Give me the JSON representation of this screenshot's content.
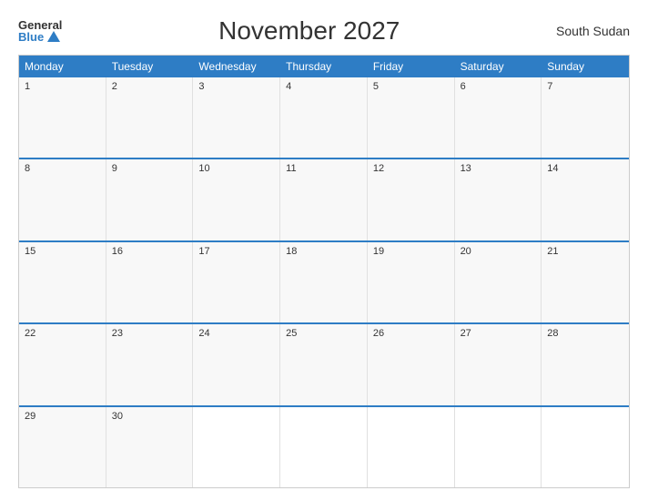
{
  "header": {
    "logo_general": "General",
    "logo_blue": "Blue",
    "title": "November 2027",
    "country": "South Sudan"
  },
  "calendar": {
    "day_headers": [
      "Monday",
      "Tuesday",
      "Wednesday",
      "Thursday",
      "Friday",
      "Saturday",
      "Sunday"
    ],
    "weeks": [
      [
        {
          "day": "1",
          "empty": false
        },
        {
          "day": "2",
          "empty": false
        },
        {
          "day": "3",
          "empty": false
        },
        {
          "day": "4",
          "empty": false
        },
        {
          "day": "5",
          "empty": false
        },
        {
          "day": "6",
          "empty": false
        },
        {
          "day": "7",
          "empty": false
        }
      ],
      [
        {
          "day": "8",
          "empty": false
        },
        {
          "day": "9",
          "empty": false
        },
        {
          "day": "10",
          "empty": false
        },
        {
          "day": "11",
          "empty": false
        },
        {
          "day": "12",
          "empty": false
        },
        {
          "day": "13",
          "empty": false
        },
        {
          "day": "14",
          "empty": false
        }
      ],
      [
        {
          "day": "15",
          "empty": false
        },
        {
          "day": "16",
          "empty": false
        },
        {
          "day": "17",
          "empty": false
        },
        {
          "day": "18",
          "empty": false
        },
        {
          "day": "19",
          "empty": false
        },
        {
          "day": "20",
          "empty": false
        },
        {
          "day": "21",
          "empty": false
        }
      ],
      [
        {
          "day": "22",
          "empty": false
        },
        {
          "day": "23",
          "empty": false
        },
        {
          "day": "24",
          "empty": false
        },
        {
          "day": "25",
          "empty": false
        },
        {
          "day": "26",
          "empty": false
        },
        {
          "day": "27",
          "empty": false
        },
        {
          "day": "28",
          "empty": false
        }
      ],
      [
        {
          "day": "29",
          "empty": false
        },
        {
          "day": "30",
          "empty": false
        },
        {
          "day": "",
          "empty": true
        },
        {
          "day": "",
          "empty": true
        },
        {
          "day": "",
          "empty": true
        },
        {
          "day": "",
          "empty": true
        },
        {
          "day": "",
          "empty": true
        }
      ]
    ]
  }
}
